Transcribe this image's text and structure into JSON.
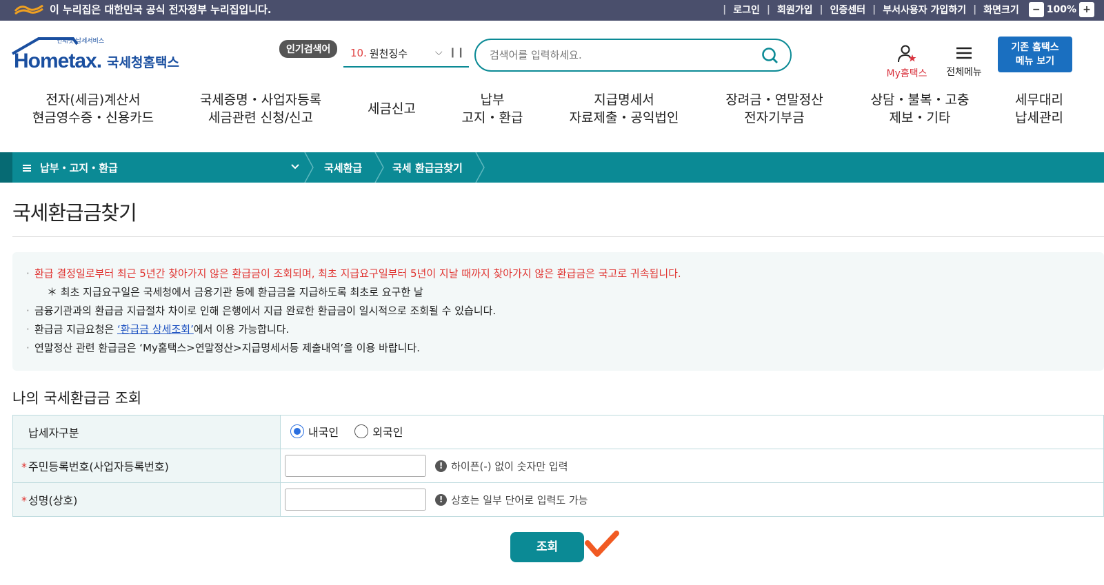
{
  "topbar": {
    "gov_text": "이 누리집은 대한민국 공식 전자정부 누리집입니다.",
    "links": [
      "로그인",
      "회원가입",
      "인증센터",
      "부서사용자 가입하기",
      "화면크기"
    ],
    "zoom": "100%"
  },
  "header": {
    "logo_small": "언제냇 납세서비스",
    "logo_text": "Hometax.",
    "logo_korean": "국세청홈택스",
    "popular_label": "인기검색어",
    "keyword_rank": "10.",
    "keyword_text": "원천징수",
    "search_placeholder": "검색어를 입력하세요.",
    "my_hometax": "My홈택스",
    "all_menu": "전체메뉴",
    "old_menu_line1": "기존 홈택스",
    "old_menu_line2": "메뉴 보기"
  },
  "gnb": [
    {
      "l1": "전자(세금)계산서",
      "l2": "현금영수증・신용카드"
    },
    {
      "l1": "국세증명・사업자등록",
      "l2": "세금관련 신청/신고"
    },
    {
      "l1": "세금신고",
      "l2": ""
    },
    {
      "l1": "납부",
      "l2": "고지・환급"
    },
    {
      "l1": "지급명세서",
      "l2": "자료제출・공익법인"
    },
    {
      "l1": "장려금・연말정산",
      "l2": "전자기부금"
    },
    {
      "l1": "상담・불복・고충",
      "l2": "제보・기타"
    },
    {
      "l1": "세무대리",
      "l2": "납세관리"
    }
  ],
  "breadcrumb": {
    "menu": "납부・고지・환급",
    "item1": "국세환급",
    "item2": "국세 환급금찾기"
  },
  "page_title": "국세환급금찾기",
  "notice": {
    "line1": "환급 결정일로부터 최근 5년간 찾아가지 않은 환급금이 조회되며, 최초 지급요구일부터 5년이 지날 때까지 찾아가지 않은 환급금은 국고로 귀속됩니다.",
    "line2": "＊ 최초 지급요구일은 국세청에서 금융기관 등에 환급금을 지급하도록 최초로 요구한 날",
    "line3": "금융기관과의 환급금 지급절차 차이로 인해 은행에서 지급 완료한 환급금이 일시적으로 조회될 수 있습니다.",
    "line4_pre": "환급금 지급요청은 ",
    "line4_link": "‘환급금 상세조회’",
    "line4_post": "에서 이용 가능합니다.",
    "line5": "연말정산 관련 환급금은 ‘My홈택스>연말정산>지급명세서등 제출내역’을 이용 바랍니다."
  },
  "section_title": "나의 국세환급금 조회",
  "form": {
    "taxpayer_label": "납세자구분",
    "radio_domestic": "내국인",
    "radio_foreign": "외국인",
    "id_label": "주민등록번호(사업자등록번호)",
    "id_hint": "하이픈(-) 없이 숫자만 입력",
    "name_label": "성명(상호)",
    "name_hint": "상호는 일부 단어로 입력도 가능",
    "required_mark": "*"
  },
  "query_button": "조회",
  "colors": {
    "teal": "#0b8a95",
    "topbar": "#4a4f6c",
    "red": "#e0322f",
    "blue_btn": "#1a6fc0",
    "checkmark": "#f15a22"
  }
}
